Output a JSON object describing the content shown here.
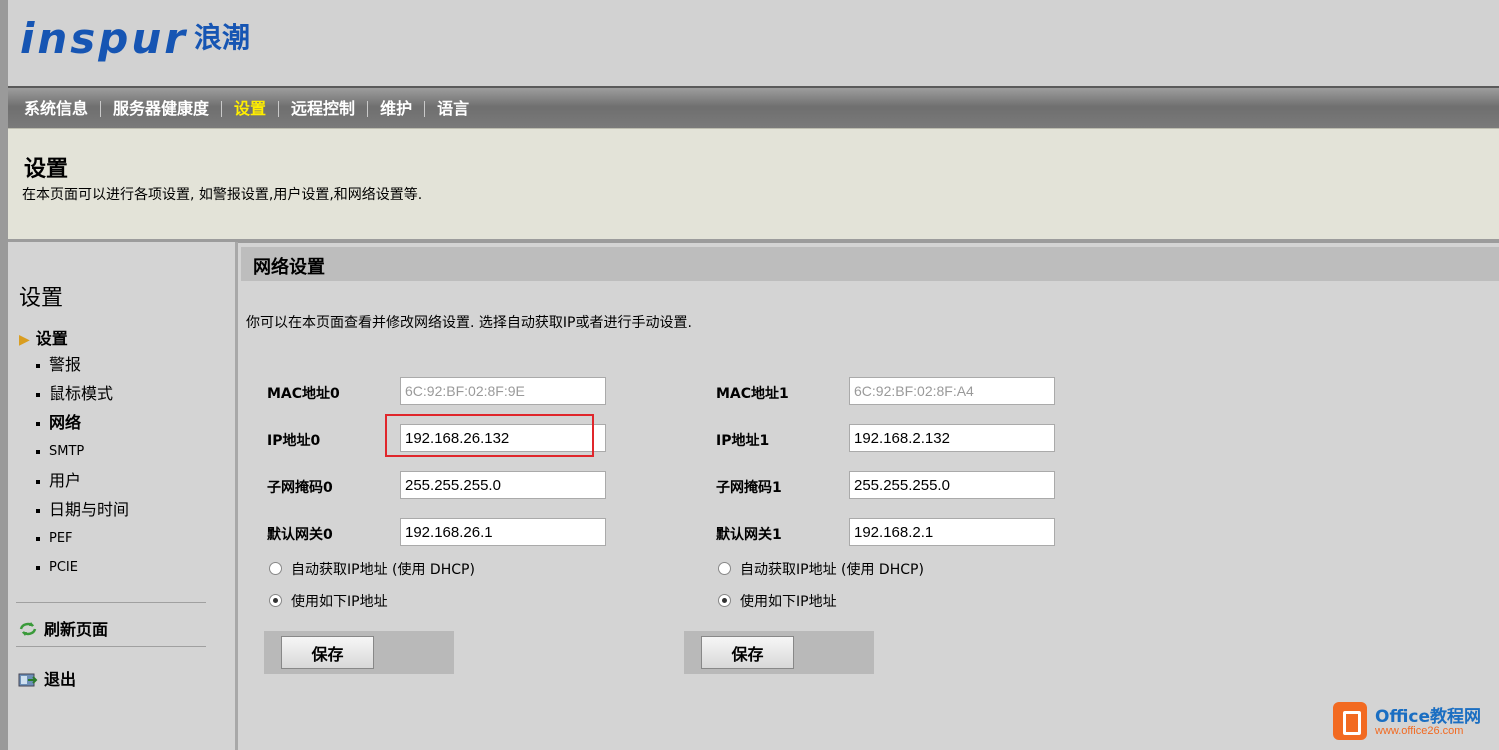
{
  "logo": {
    "brand": "inspur",
    "cn": "浪潮"
  },
  "nav": [
    "系统信息",
    "服务器健康度",
    "设置",
    "远程控制",
    "维护",
    "语言"
  ],
  "nav_active": "设置",
  "banner": {
    "title": "设置",
    "desc": "在本页面可以进行各项设置, 如警报设置,用户设置,和网络设置等."
  },
  "sidebar": {
    "title": "设置",
    "current": "设置",
    "items": [
      "警报",
      "鼠标模式",
      "网络",
      "SMTP",
      "用户",
      "日期与时间",
      "PEF",
      "PCIE"
    ],
    "refresh": "刷新页面",
    "logout": "退出"
  },
  "section": {
    "title": "网络设置",
    "desc": "你可以在本页面查看并修改网络设置. 选择自动获取IP或者进行手动设置."
  },
  "iface0": {
    "mac_label": "MAC地址0",
    "mac": "6C:92:BF:02:8F:9E",
    "ip_label": "IP地址0",
    "ip": "192.168.26.132",
    "mask_label": "子网掩码0",
    "mask": "255.255.255.0",
    "gw_label": "默认网关0",
    "gw": "192.168.26.1",
    "dhcp": "自动获取IP地址 (使用  DHCP)",
    "static": "使用如下IP地址",
    "save": "保存"
  },
  "iface1": {
    "mac_label": "MAC地址1",
    "mac": "6C:92:BF:02:8F:A4",
    "ip_label": "IP地址1",
    "ip": "192.168.2.132",
    "mask_label": "子网掩码1",
    "mask": "255.255.255.0",
    "gw_label": "默认网关1",
    "gw": "192.168.2.1",
    "dhcp": "自动获取IP地址 (使用  DHCP)",
    "static": "使用如下IP地址",
    "save": "保存"
  },
  "watermark": {
    "line1": "Office教程网",
    "line2": "www.office26.com"
  },
  "colors": {
    "brand": "#1655b3",
    "nav_active": "#ffee00",
    "highlight_box": "#e0262b",
    "watermark": "#f26a21"
  }
}
